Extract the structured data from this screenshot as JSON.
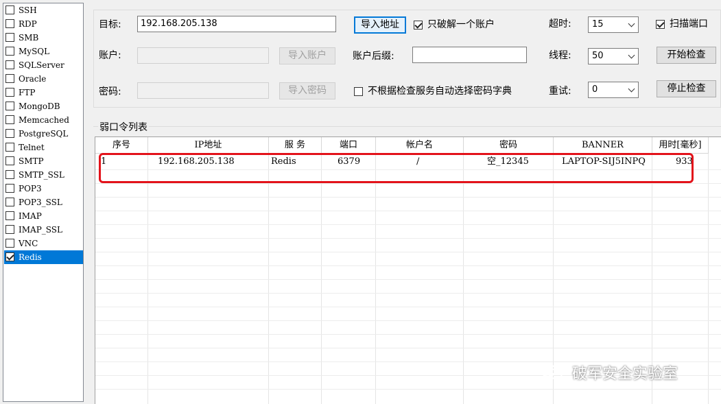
{
  "services": [
    {
      "label": "SSH",
      "checked": false
    },
    {
      "label": "RDP",
      "checked": false
    },
    {
      "label": "SMB",
      "checked": false
    },
    {
      "label": "MySQL",
      "checked": false
    },
    {
      "label": "SQLServer",
      "checked": false
    },
    {
      "label": "Oracle",
      "checked": false
    },
    {
      "label": "FTP",
      "checked": false
    },
    {
      "label": "MongoDB",
      "checked": false
    },
    {
      "label": "Memcached",
      "checked": false
    },
    {
      "label": "PostgreSQL",
      "checked": false
    },
    {
      "label": "Telnet",
      "checked": false
    },
    {
      "label": "SMTP",
      "checked": false
    },
    {
      "label": "SMTP_SSL",
      "checked": false
    },
    {
      "label": "POP3",
      "checked": false
    },
    {
      "label": "POP3_SSL",
      "checked": false
    },
    {
      "label": "IMAP",
      "checked": false
    },
    {
      "label": "IMAP_SSL",
      "checked": false
    },
    {
      "label": "VNC",
      "checked": false
    },
    {
      "label": "Redis",
      "checked": true,
      "selected": true
    }
  ],
  "options": {
    "target_label": "目标:",
    "target_value": "192.168.205.138",
    "import_address": "导入地址",
    "only_one_account": "只破解一个账户",
    "only_one_account_checked": true,
    "timeout_label": "超时:",
    "timeout_value": "15",
    "scan_port": "扫描端口",
    "scan_port_checked": true,
    "account_label": "账户:",
    "import_account": "导入账户",
    "account_suffix_label": "账户后缀:",
    "threads_label": "线程:",
    "threads_value": "50",
    "start_check": "开始检查",
    "password_label": "密码:",
    "import_password": "导入密码",
    "auto_dict": "不根据检查服务自动选择密码字典",
    "auto_dict_checked": false,
    "retry_label": "重试:",
    "retry_value": "0",
    "stop_check": "停止检查"
  },
  "results": {
    "title": "弱口令列表",
    "columns": [
      "序号",
      "IP地址",
      "服 务",
      "端口",
      "帐户名",
      "密码",
      "BANNER",
      "用时[毫秒]"
    ],
    "rows": [
      [
        "1",
        "192.168.205.138",
        "Redis",
        "6379",
        "/",
        "空_12345",
        "LAPTOP-SIJ5INPQ",
        "933"
      ]
    ]
  },
  "watermark": "破军安全实验室"
}
